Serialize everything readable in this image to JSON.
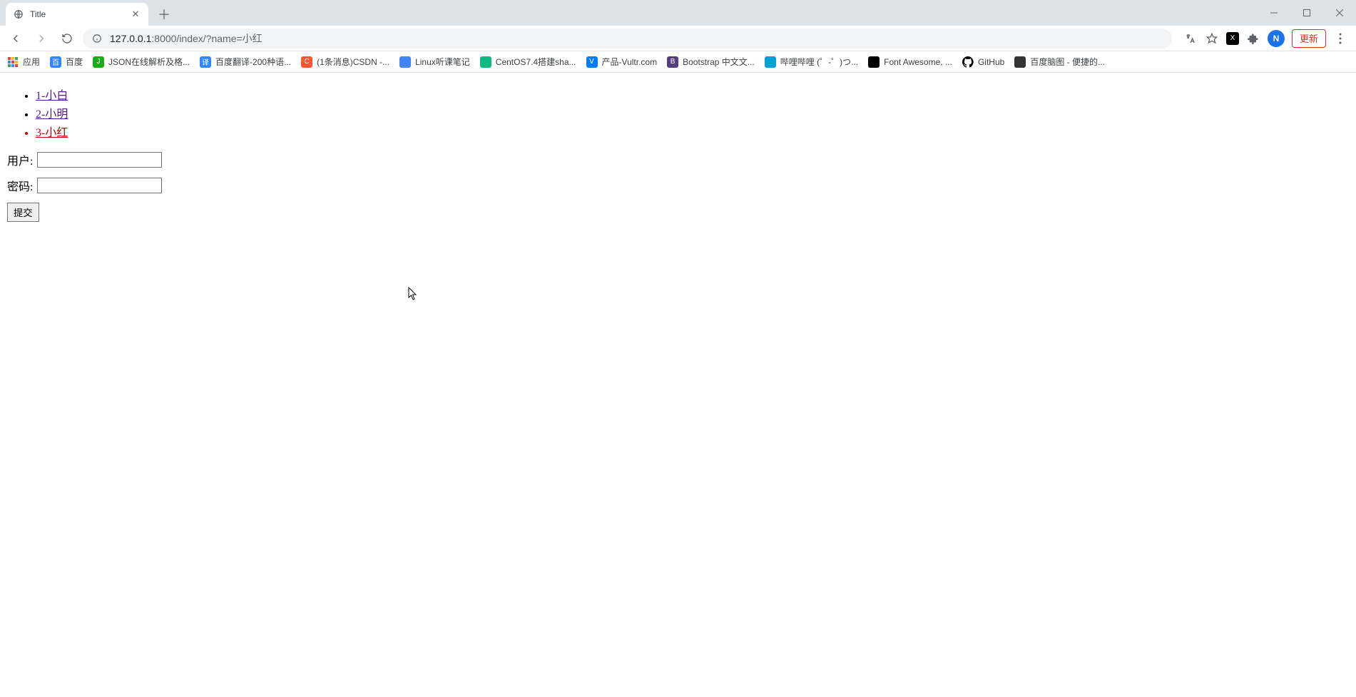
{
  "window": {
    "tab_title": "Title",
    "update_label": "更新",
    "avatar_letter": "N"
  },
  "address": {
    "host": "127.0.0.1",
    "port_path": ":8000/index/?name=小红"
  },
  "bookmarks": [
    {
      "label": "应用",
      "icon_bg": "transparent",
      "icon_kind": "apps"
    },
    {
      "label": "百度",
      "icon_bg": "#3385ff",
      "icon_text": "百"
    },
    {
      "label": "JSON在线解析及格...",
      "icon_bg": "#1aad19",
      "icon_text": "J"
    },
    {
      "label": "百度翻译-200种语...",
      "icon_bg": "#3385ff",
      "icon_text": "译"
    },
    {
      "label": "(1条消息)CSDN -...",
      "icon_bg": "#fc5531",
      "icon_text": "C"
    },
    {
      "label": "Linux听课笔记",
      "icon_bg": "#4285f4",
      "icon_text": ""
    },
    {
      "label": "CentOS7.4搭建sha...",
      "icon_bg": "#10b981",
      "icon_text": ""
    },
    {
      "label": "产品-Vultr.com",
      "icon_bg": "#007bfc",
      "icon_text": "V"
    },
    {
      "label": "Bootstrap 中文文...",
      "icon_bg": "#563d7c",
      "icon_text": "B"
    },
    {
      "label": "哔哩哔哩 (゜-゜)つ...",
      "icon_bg": "#00a1d6",
      "icon_text": ""
    },
    {
      "label": "Font Awesome, ...",
      "icon_bg": "#000",
      "icon_text": ""
    },
    {
      "label": "GitHub",
      "icon_bg": "#000",
      "icon_kind": "github"
    },
    {
      "label": "百度脑图 - 便捷的...",
      "icon_bg": "#333",
      "icon_text": ""
    }
  ],
  "page": {
    "links": [
      {
        "text": "1-小白",
        "current": false
      },
      {
        "text": "2-小明",
        "current": false
      },
      {
        "text": "3-小红",
        "current": true
      }
    ],
    "user_label": "用户:",
    "password_label": "密码:",
    "user_value": "",
    "password_value": "",
    "submit_label": "提交"
  }
}
